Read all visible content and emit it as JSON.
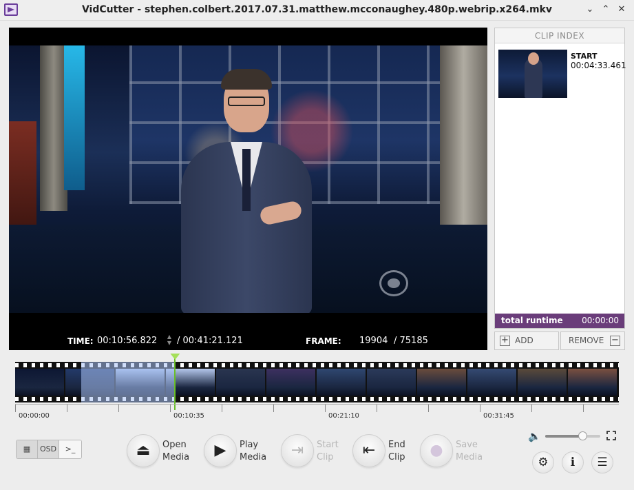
{
  "window": {
    "title": "VidCutter - stephen.colbert.2017.07.31.matthew.mcconaughey.480p.webrip.x264.mkv",
    "min_glyph": "⌄",
    "max_glyph": "⌃",
    "close_glyph": "✕"
  },
  "player": {
    "time_label": "TIME:",
    "current_time": "00:10:56.822",
    "total_time": "/ 00:41:21.121",
    "frame_label": "FRAME:",
    "current_frame": "19904",
    "total_frames": "/ 75185"
  },
  "clip_index": {
    "header": "CLIP INDEX",
    "items": [
      {
        "label": "START",
        "time": "00:04:33.461"
      }
    ],
    "runtime_label": "total runtime",
    "runtime_value": "00:00:00",
    "add_label": "ADD",
    "remove_label": "REMOVE"
  },
  "timeline": {
    "tick_labels": [
      "00:00:00",
      "00:10:35",
      "00:21:10",
      "00:31:45"
    ],
    "playhead_fraction": 0.265,
    "selection_start_fraction": 0.11,
    "selection_end_fraction": 0.265
  },
  "view_modes": [
    {
      "label": "▦",
      "icon": "video-mode-icon"
    },
    {
      "label": "OSD",
      "icon": ""
    },
    {
      "label": ">_",
      "icon": "console-icon"
    }
  ],
  "controls": {
    "open_media": {
      "line1": "Open",
      "line2": "Media",
      "glyph": "⏏"
    },
    "play_media": {
      "line1": "Play",
      "line2": "Media",
      "glyph": "▶"
    },
    "start_clip": {
      "line1": "Start",
      "line2": "Clip",
      "glyph": "⇥"
    },
    "end_clip": {
      "line1": "End",
      "line2": "Clip",
      "glyph": "⇤"
    },
    "save_media": {
      "line1": "Save",
      "line2": "Media",
      "glyph": "●"
    }
  },
  "volume": {
    "level": 0.68,
    "icon": "speaker-icon"
  },
  "tools": {
    "settings_glyph": "⚙",
    "info_glyph": "i",
    "menu_glyph": "☰"
  },
  "colors": {
    "accent": "#6a3d7a",
    "playhead": "#6abf2a"
  },
  "thumbnails": [
    "#0d1733",
    "#233a6a",
    "#a9c0e8",
    "#b4c7ec",
    "#2a3550",
    "#3d3060",
    "#2f4770",
    "#2b3a5a",
    "#6a4c3c",
    "#354a72",
    "#5a4a3a",
    "#7a5040"
  ]
}
